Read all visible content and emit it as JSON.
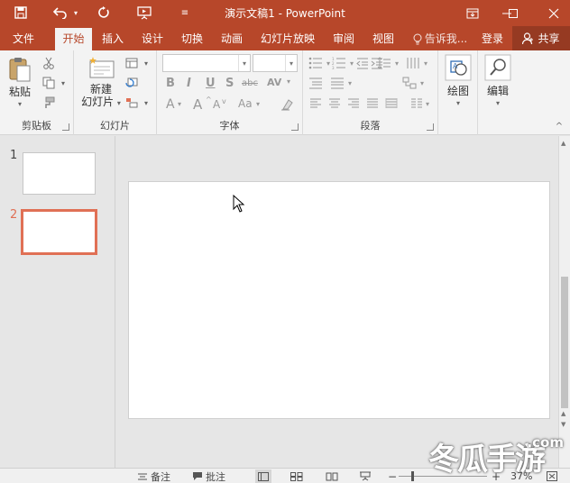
{
  "window": {
    "title": "演示文稿1 - PowerPoint"
  },
  "ribbon_tabs": [
    {
      "label": "文件"
    },
    {
      "label": "开始"
    },
    {
      "label": "插入"
    },
    {
      "label": "设计"
    },
    {
      "label": "切换"
    },
    {
      "label": "动画"
    },
    {
      "label": "幻灯片放映"
    },
    {
      "label": "审阅"
    },
    {
      "label": "视图"
    }
  ],
  "tell_me": {
    "placeholder": "告诉我..."
  },
  "account": {
    "sign_in": "登录",
    "share": "共享"
  },
  "groups": {
    "clipboard": {
      "label": "剪贴板",
      "paste": "粘贴"
    },
    "slides": {
      "label": "幻灯片",
      "new_slide_line1": "新建",
      "new_slide_line2": "幻灯片"
    },
    "font": {
      "label": "字体",
      "font_name": "",
      "font_size": ""
    },
    "paragraph": {
      "label": "段落"
    },
    "drawing": {
      "label": "绘图"
    },
    "editing": {
      "label": "编辑"
    }
  },
  "slides": [
    {
      "number": "1"
    },
    {
      "number": "2"
    }
  ],
  "status": {
    "notes": "备注",
    "comments": "批注",
    "zoom": "37%"
  },
  "watermark": {
    "brand": "冬瓜手游",
    "domain": ".com"
  },
  "colors": {
    "accent": "#b7472a",
    "thumb_selected_border": "#e07055"
  }
}
